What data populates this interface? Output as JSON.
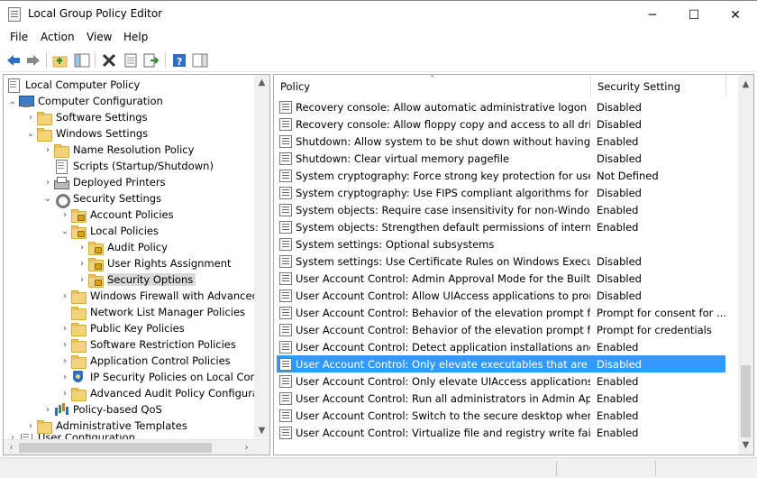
{
  "window": {
    "title": "Local Group Policy Editor",
    "minimize": "─",
    "maximize": "☐",
    "close": "✕"
  },
  "menu": [
    "File",
    "Action",
    "View",
    "Help"
  ],
  "toolbar": [
    "back-icon",
    "forward-icon",
    "up-folder-icon",
    "show-hide-tree-icon",
    "delete-icon",
    "properties-icon",
    "export-list-icon",
    "help-icon",
    "show-hide-action-pane-icon"
  ],
  "tree": [
    {
      "label": "Local Computer Policy",
      "icon": "doc"
    },
    {
      "label": "Computer Configuration",
      "icon": "computer"
    },
    {
      "label": "Software Settings",
      "icon": "folder"
    },
    {
      "label": "Windows Settings",
      "icon": "folder"
    },
    {
      "label": "Name Resolution Policy",
      "icon": "folder"
    },
    {
      "label": "Scripts (Startup/Shutdown)",
      "icon": "doc"
    },
    {
      "label": "Deployed Printers",
      "icon": "printer"
    },
    {
      "label": "Security Settings",
      "icon": "gear"
    },
    {
      "label": "Account Policies",
      "icon": "folder-lock"
    },
    {
      "label": "Local Policies",
      "icon": "folder-lock"
    },
    {
      "label": "Audit Policy",
      "icon": "folder-lock"
    },
    {
      "label": "User Rights Assignment",
      "icon": "folder-lock"
    },
    {
      "label": "Security Options",
      "icon": "folder-lock"
    },
    {
      "label": "Windows Firewall with Advanced",
      "icon": "folder"
    },
    {
      "label": "Network List Manager Policies",
      "icon": "folder"
    },
    {
      "label": "Public Key Policies",
      "icon": "folder"
    },
    {
      "label": "Software Restriction Policies",
      "icon": "folder"
    },
    {
      "label": "Application Control Policies",
      "icon": "folder"
    },
    {
      "label": "IP Security Policies on Local Comp",
      "icon": "shieldkey"
    },
    {
      "label": "Advanced Audit Policy Configurat",
      "icon": "folder"
    },
    {
      "label": "Policy-based QoS",
      "icon": "barchart"
    },
    {
      "label": "Administrative Templates",
      "icon": "folder"
    },
    {
      "label": "User Configuration",
      "icon": "doc"
    }
  ],
  "list": {
    "columns": {
      "policy": "Policy",
      "setting": "Security Setting"
    },
    "rows": [
      {
        "policy": "Recovery console: Allow automatic administrative logon",
        "setting": "Disabled"
      },
      {
        "policy": "Recovery console: Allow floppy copy and access to all drives...",
        "setting": "Disabled"
      },
      {
        "policy": "Shutdown: Allow system to be shut down without having to...",
        "setting": "Enabled"
      },
      {
        "policy": "Shutdown: Clear virtual memory pagefile",
        "setting": "Disabled"
      },
      {
        "policy": "System cryptography: Force strong key protection for user k...",
        "setting": "Not Defined"
      },
      {
        "policy": "System cryptography: Use FIPS compliant algorithms for en...",
        "setting": "Disabled"
      },
      {
        "policy": "System objects: Require case insensitivity for non-Windows ...",
        "setting": "Enabled"
      },
      {
        "policy": "System objects: Strengthen default permissions of internal s...",
        "setting": "Enabled"
      },
      {
        "policy": "System settings: Optional subsystems",
        "setting": ""
      },
      {
        "policy": "System settings: Use Certificate Rules on Windows Executabl...",
        "setting": "Disabled"
      },
      {
        "policy": "User Account Control: Admin Approval Mode for the Built-i...",
        "setting": "Disabled"
      },
      {
        "policy": "User Account Control: Allow UIAccess applications to prom...",
        "setting": "Disabled"
      },
      {
        "policy": "User Account Control: Behavior of the elevation prompt for ...",
        "setting": "Prompt for consent for ..."
      },
      {
        "policy": "User Account Control: Behavior of the elevation prompt for ...",
        "setting": "Prompt for credentials"
      },
      {
        "policy": "User Account Control: Detect application installations and p...",
        "setting": "Enabled"
      },
      {
        "policy": "User Account Control: Only elevate executables that are sign...",
        "setting": "Disabled"
      },
      {
        "policy": "User Account Control: Only elevate UIAccess applications th...",
        "setting": "Enabled"
      },
      {
        "policy": "User Account Control: Run all administrators in Admin Appr...",
        "setting": "Enabled"
      },
      {
        "policy": "User Account Control: Switch to the secure desktop when pr...",
        "setting": "Enabled"
      },
      {
        "policy": "User Account Control: Virtualize file and registry write failure...",
        "setting": "Enabled"
      }
    ]
  }
}
